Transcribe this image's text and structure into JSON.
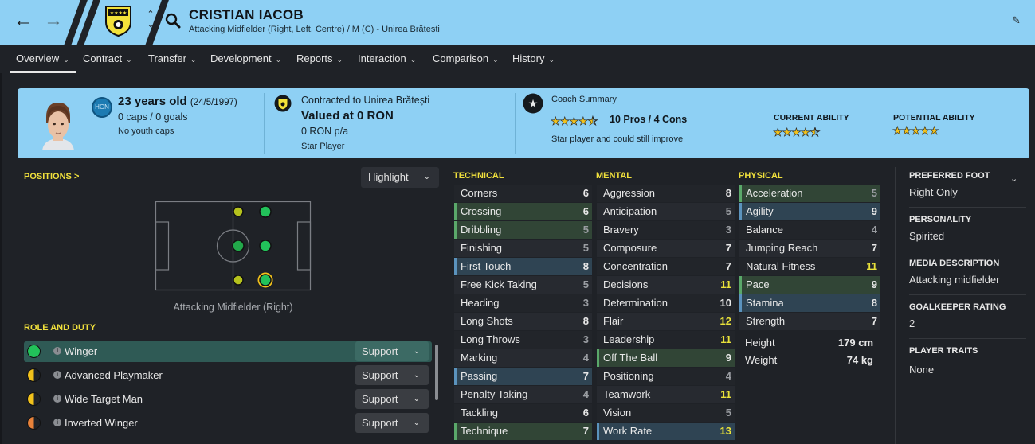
{
  "header": {
    "player_name": "CRISTIAN IACOB",
    "subtitle": "Attacking Midfielder (Right, Left, Centre) / M (C) - Unirea Brătești",
    "back_icon": "arrow-left-icon",
    "forward_icon": "arrow-right-icon",
    "search_icon": "search-icon"
  },
  "nav": {
    "items": [
      {
        "label": "Overview"
      },
      {
        "label": "Contract"
      },
      {
        "label": "Transfer"
      },
      {
        "label": "Development"
      },
      {
        "label": "Reports"
      },
      {
        "label": "Interaction"
      },
      {
        "label": "Comparison"
      },
      {
        "label": "History"
      }
    ],
    "active": "Overview"
  },
  "summary": {
    "age": "23 years old",
    "dob": "(24/5/1997)",
    "caps": "0 caps / 0 goals",
    "youth_caps": "No youth caps",
    "nation_code": "HGN",
    "contracted": "Contracted to Unirea Brătești",
    "valued": "Valued at 0 RON",
    "wage": "0 RON p/a",
    "status": "Star Player",
    "coach_title": "Coach Summary",
    "coach_rating": 4.5,
    "pros_cons": "10 Pros / 4 Cons",
    "coach_note": "Star player and could still improve",
    "current_ability_label": "CURRENT ABILITY",
    "current_ability_stars": 4.5,
    "potential_ability_label": "POTENTIAL ABILITY",
    "potential_ability_stars": 5
  },
  "positions": {
    "title": "POSITIONS >",
    "highlight_label": "Highlight",
    "caption": "Attacking Midfielder (Right)"
  },
  "roles": {
    "title": "ROLE AND DUTY",
    "items": [
      {
        "name": "Winger",
        "duty": "Support",
        "suitability": "full",
        "color": "#22c25a"
      },
      {
        "name": "Advanced Playmaker",
        "duty": "Support",
        "suitability": "half",
        "color": "#f2c21b"
      },
      {
        "name": "Wide Target Man",
        "duty": "Support",
        "suitability": "half",
        "color": "#f2c21b"
      },
      {
        "name": "Inverted Winger",
        "duty": "Support",
        "suitability": "half",
        "color": "#e8823a"
      }
    ]
  },
  "technical": {
    "title": "TECHNICAL",
    "items": [
      {
        "name": "Corners",
        "value": "6"
      },
      {
        "name": "Crossing",
        "value": "6"
      },
      {
        "name": "Dribbling",
        "value": "5"
      },
      {
        "name": "Finishing",
        "value": "5"
      },
      {
        "name": "First Touch",
        "value": "8"
      },
      {
        "name": "Free Kick Taking",
        "value": "5"
      },
      {
        "name": "Heading",
        "value": "3"
      },
      {
        "name": "Long Shots",
        "value": "8"
      },
      {
        "name": "Long Throws",
        "value": "3"
      },
      {
        "name": "Marking",
        "value": "4"
      },
      {
        "name": "Passing",
        "value": "7"
      },
      {
        "name": "Penalty Taking",
        "value": "4"
      },
      {
        "name": "Tackling",
        "value": "6"
      },
      {
        "name": "Technique",
        "value": "7"
      }
    ]
  },
  "mental": {
    "title": "MENTAL",
    "items": [
      {
        "name": "Aggression",
        "value": "8"
      },
      {
        "name": "Anticipation",
        "value": "5"
      },
      {
        "name": "Bravery",
        "value": "3"
      },
      {
        "name": "Composure",
        "value": "7"
      },
      {
        "name": "Concentration",
        "value": "7"
      },
      {
        "name": "Decisions",
        "value": "11"
      },
      {
        "name": "Determination",
        "value": "10"
      },
      {
        "name": "Flair",
        "value": "12"
      },
      {
        "name": "Leadership",
        "value": "11"
      },
      {
        "name": "Off The Ball",
        "value": "9"
      },
      {
        "name": "Positioning",
        "value": "4"
      },
      {
        "name": "Teamwork",
        "value": "11"
      },
      {
        "name": "Vision",
        "value": "5"
      },
      {
        "name": "Work Rate",
        "value": "13"
      }
    ]
  },
  "physical": {
    "title": "PHYSICAL",
    "items": [
      {
        "name": "Acceleration",
        "value": "5"
      },
      {
        "name": "Agility",
        "value": "9"
      },
      {
        "name": "Balance",
        "value": "4"
      },
      {
        "name": "Jumping Reach",
        "value": "7"
      },
      {
        "name": "Natural Fitness",
        "value": "11"
      },
      {
        "name": "Pace",
        "value": "9"
      },
      {
        "name": "Stamina",
        "value": "8"
      },
      {
        "name": "Strength",
        "value": "7"
      }
    ],
    "height_label": "Height",
    "height": "179 cm",
    "weight_label": "Weight",
    "weight": "74 kg"
  },
  "info": {
    "preferred_foot_label": "PREFERRED FOOT",
    "preferred_foot": "Right Only",
    "personality_label": "PERSONALITY",
    "personality": "Spirited",
    "media_label": "MEDIA DESCRIPTION",
    "media": "Attacking midfielder",
    "gk_label": "GOALKEEPER RATING",
    "gk": "2",
    "traits_label": "PLAYER TRAITS",
    "traits": "None"
  }
}
